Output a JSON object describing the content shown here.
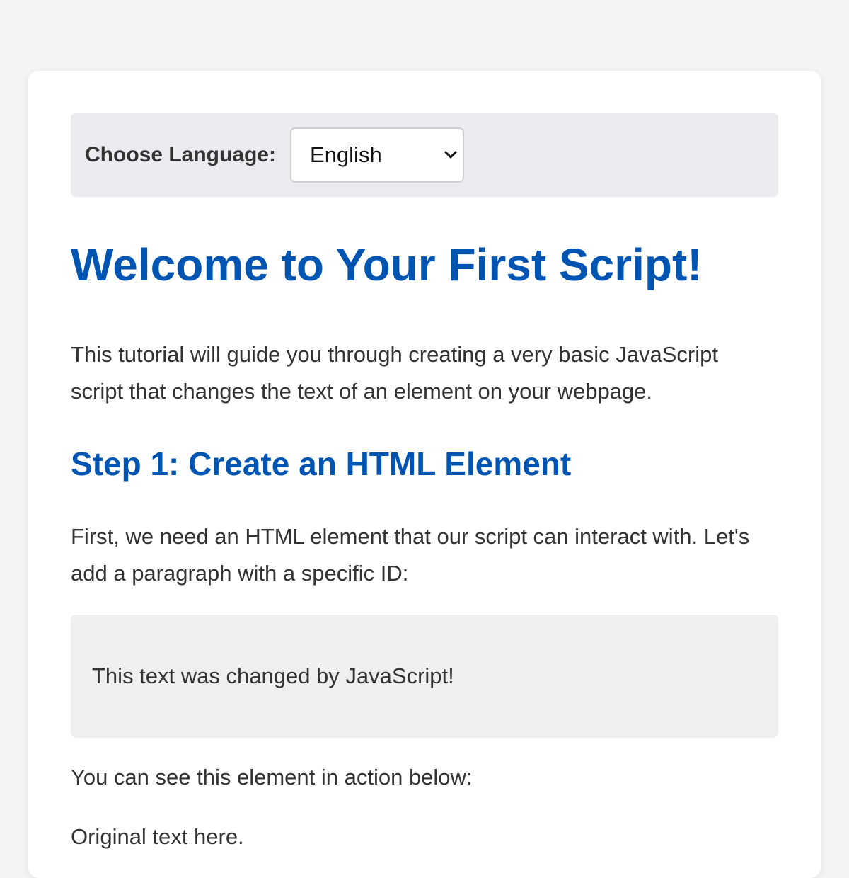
{
  "language_bar": {
    "label": "Choose Language:",
    "selected": "English"
  },
  "tutorial": {
    "title": "Welcome to Your First Script!",
    "intro": "This tutorial will guide you through creating a very basic JavaScript script that changes the text of an element on your webpage.",
    "step1_heading": "Step 1: Create an HTML Element",
    "step1_description": "First, we need an HTML element that our script can interact with. Let's add a paragraph with a specific ID:",
    "demo_text": "This text was changed by JavaScript!",
    "see_below": "You can see this element in action below:",
    "original_text": "Original text here."
  },
  "colors": {
    "heading": "#0055b3",
    "body_text": "#333333",
    "page_background": "#f4f4f4",
    "language_bar_background": "#ebecef",
    "demo_box_background": "#efeff0"
  },
  "icons": {
    "select_arrow": "chevron-down-icon"
  }
}
